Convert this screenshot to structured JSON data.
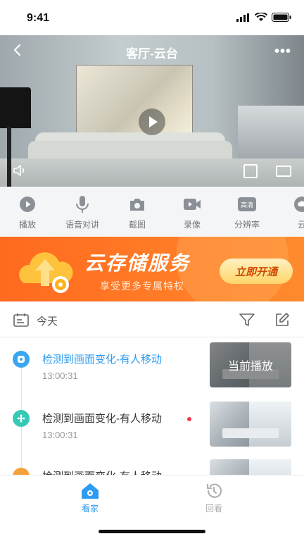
{
  "status_bar": {
    "time": "9:41"
  },
  "video": {
    "title": "客厅-云台",
    "more": "•••"
  },
  "toolbar": {
    "items": [
      {
        "label": "播放",
        "icon": "play-circle-icon"
      },
      {
        "label": "语音对讲",
        "icon": "microphone-icon"
      },
      {
        "label": "截图",
        "icon": "camera-icon"
      },
      {
        "label": "录像",
        "icon": "video-record-icon"
      },
      {
        "label": "分辨率",
        "icon": "resolution-icon",
        "badge": "高清"
      },
      {
        "label": "云",
        "icon": "cloud-icon"
      }
    ]
  },
  "banner": {
    "title": "云存储服务",
    "subtitle": "享受更多专属特权",
    "button": "立即开通",
    "colors": {
      "start": "#ff6a1f",
      "end": "#ff8a2e"
    }
  },
  "date_filter": {
    "label": "今天"
  },
  "events": [
    {
      "title": "检测到画面变化-有人移动",
      "time": "13:00:31",
      "active": true,
      "thumb_label": "当前播放",
      "color": "#3aa7f0"
    },
    {
      "title": "检测到画面变化-有人移动",
      "time": "13:00:31",
      "active": false,
      "unread": true,
      "color": "#36c9b6"
    },
    {
      "title": "检测到画面变化-有人移动",
      "time": "",
      "active": false,
      "unread": true,
      "color": "#f5a13a"
    }
  ],
  "tabbar": {
    "tabs": [
      {
        "label": "看家",
        "active": true
      },
      {
        "label": "回看",
        "active": false
      }
    ]
  },
  "colors": {
    "accent": "#2d9cf0",
    "inactive": "#b0b0b0"
  }
}
